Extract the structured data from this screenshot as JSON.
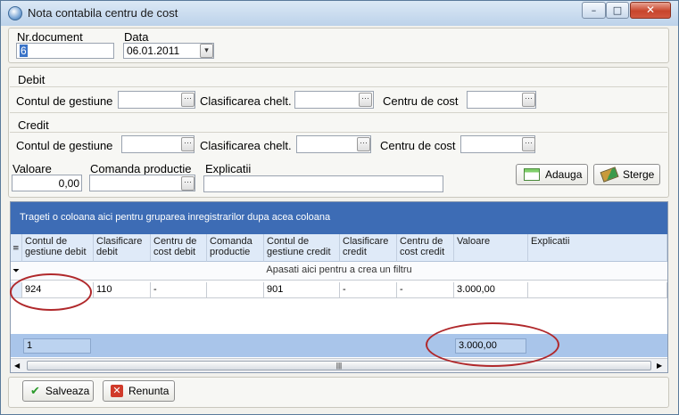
{
  "window": {
    "title": "Nota contabila centru de cost",
    "minimize": "–",
    "maximize": "□",
    "close": "✕"
  },
  "header": {
    "nr_label": "Nr.document",
    "nr_value": "6",
    "date_label": "Data",
    "date_value": "06.01.2011"
  },
  "debit": {
    "section_label": "Debit",
    "cont_label": "Contul de gestiune",
    "clasif_label": "Clasificarea chelt.",
    "centru_label": "Centru de cost",
    "cont_value": "",
    "clasif_value": "",
    "centru_value": ""
  },
  "credit": {
    "section_label": "Credit",
    "cont_label": "Contul de gestiune",
    "clasif_label": "Clasificarea chelt.",
    "centru_label": "Centru de cost",
    "cont_value": "",
    "clasif_value": "",
    "centru_value": ""
  },
  "entry": {
    "valoare_label": "Valoare",
    "valoare_value": "0,00",
    "comanda_label": "Comanda productie",
    "comanda_value": "",
    "explicatii_label": "Explicatii",
    "explicatii_value": ""
  },
  "actions": {
    "add_label": "Adauga",
    "delete_label": "Sterge"
  },
  "grid": {
    "group_hint": "Trageti o coloana aici pentru gruparea inregistrarilor dupa acea coloana",
    "filter_hint": "Apasati aici pentru a crea un filtru",
    "columns": [
      "Contul de gestiune debit",
      "Clasificare debit",
      "Centru de cost debit",
      "Comanda productie",
      "Contul de gestiune credit",
      "Clasificare credit",
      "Centru de cost credit",
      "Valoare",
      "Explicatii"
    ],
    "rows": [
      [
        "924",
        "110",
        "-",
        "",
        "901",
        "-",
        "-",
        "3.000,00",
        ""
      ]
    ],
    "footer_count": "1",
    "footer_total": "3.000,00",
    "scroll_grip": "|||"
  },
  "bottom": {
    "save_label": "Salveaza",
    "cancel_label": "Renunta"
  },
  "colors": {
    "grid_group_bar": "#3d6cb5",
    "annotation_ring": "#b0282b"
  }
}
